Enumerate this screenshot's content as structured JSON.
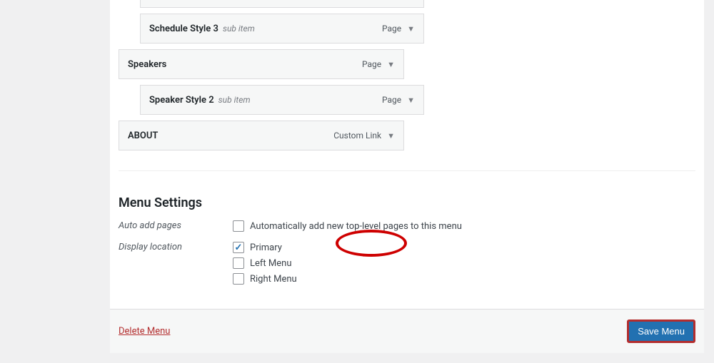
{
  "menu_items": [
    {
      "title": "Schedule Style 3",
      "sub": "sub item",
      "type": "Page",
      "level": 1
    },
    {
      "title": "Speakers",
      "sub": "",
      "type": "Page",
      "level": 0
    },
    {
      "title": "Speaker Style 2",
      "sub": "sub item",
      "type": "Page",
      "level": 1
    },
    {
      "title": "ABOUT",
      "sub": "",
      "type": "Custom Link",
      "level": 0
    }
  ],
  "settings": {
    "heading": "Menu Settings",
    "auto_add": {
      "label": "Auto add pages",
      "option": "Automatically add new top-level pages to this menu",
      "checked": false
    },
    "display_location": {
      "label": "Display location",
      "options": [
        {
          "label": "Primary",
          "checked": true
        },
        {
          "label": "Left Menu",
          "checked": false
        },
        {
          "label": "Right Menu",
          "checked": false
        }
      ]
    }
  },
  "footer": {
    "delete": "Delete Menu",
    "save": "Save Menu"
  }
}
